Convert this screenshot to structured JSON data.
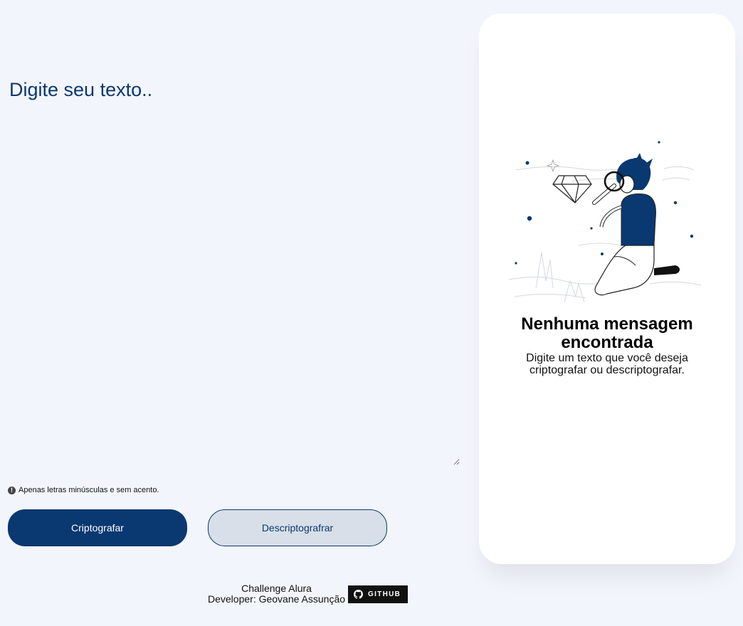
{
  "input": {
    "placeholder": "Digite seu texto.."
  },
  "hint": {
    "icon": "exclamation-circle-icon",
    "text": "Apenas letras minúsculas e sem acento."
  },
  "buttons": {
    "encrypt_label": "Criptografar",
    "decrypt_label": "Descriptografrar"
  },
  "footer": {
    "line1": "Challenge Alura",
    "line2": "Developer: Geovane Assunção",
    "github_label": "GITHUB"
  },
  "output_panel": {
    "title": "Nenhuma mensagem encontrada",
    "subtitle": "Digite um texto que você deseja criptografar ou descriptografar."
  },
  "colors": {
    "background": "#f3f5fc",
    "primary": "#0a3871",
    "secondary_button": "#d8dfe8",
    "panel": "#ffffff"
  }
}
